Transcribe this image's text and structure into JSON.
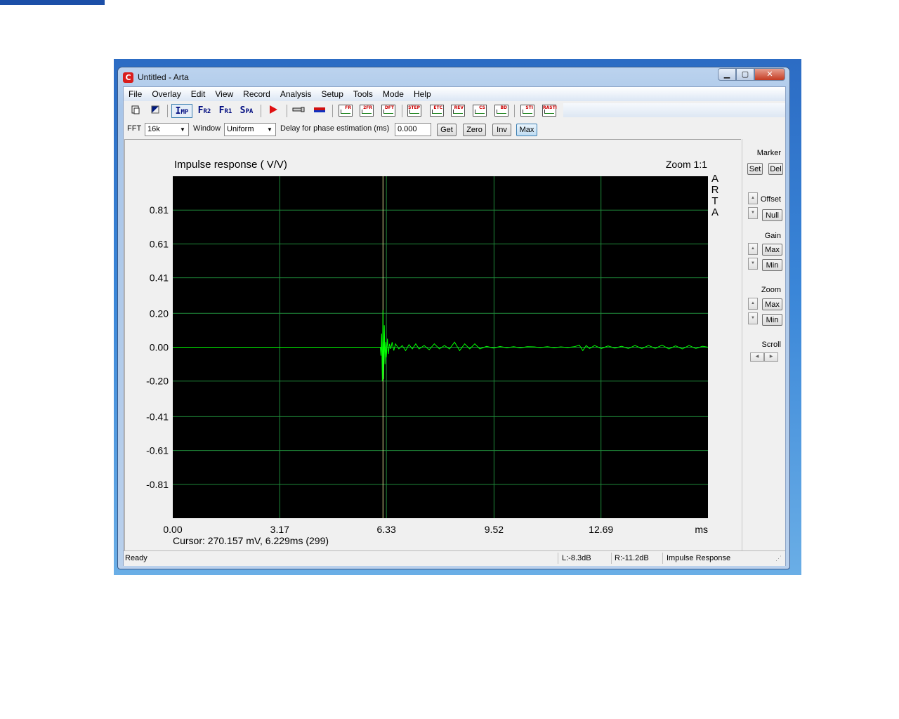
{
  "window": {
    "title": "Untitled - Arta"
  },
  "menu": [
    "File",
    "Overlay",
    "Edit",
    "View",
    "Record",
    "Analysis",
    "Setup",
    "Tools",
    "Mode",
    "Help"
  ],
  "toolbar": {
    "imp": {
      "main": "I",
      "sub": "MP"
    },
    "fr2": {
      "main": "F",
      "sub": "R2"
    },
    "fr1": {
      "main": "F",
      "sub": "R1"
    },
    "spa": {
      "main": "S",
      "sub": "PA"
    },
    "icons": [
      "FR",
      "2FR",
      "DFT",
      "STEP",
      "ETC",
      "REV",
      "CS",
      "BD",
      "STI",
      "RASTI"
    ]
  },
  "options": {
    "fft_label": "FFT",
    "fft_value": "16k",
    "window_label": "Window",
    "window_value": "Uniform",
    "delay_label": "Delay for phase estimation (ms)",
    "delay_value": "0.000",
    "get": "Get",
    "zero": "Zero",
    "inv": "Inv",
    "max": "Max"
  },
  "plot": {
    "title": "Impulse response ( V/V)",
    "zoom": "Zoom 1:1",
    "brand": [
      "A",
      "R",
      "T",
      "A"
    ],
    "cursor": "Cursor: 270.157 mV, 6.229ms (299)",
    "trace_color": "#00ff00",
    "grid_color": "#1f8a3a",
    "background": "#000000"
  },
  "chart_data": {
    "type": "line",
    "title": "Impulse response ( V/V)",
    "xlabel": "ms",
    "ylabel": "",
    "x_ticks": [
      "0.00",
      "3.17",
      "6.33",
      "9.52",
      "12.69"
    ],
    "x_unit": "ms",
    "y_ticks": [
      "0.81",
      "0.61",
      "0.41",
      "0.20",
      "0.00",
      "-0.20",
      "-0.41",
      "-0.61",
      "-0.81"
    ],
    "xlim": [
      0,
      15.86
    ],
    "ylim": [
      -1.01,
      1.01
    ],
    "cursor_x": 6.229,
    "series": [
      {
        "x": [
          0,
          6.15,
          6.17,
          6.19,
          6.21,
          6.23,
          6.25,
          6.27,
          6.29,
          6.31,
          6.33,
          6.36,
          6.39,
          6.42,
          6.46,
          6.5,
          6.55,
          6.6,
          6.7,
          6.8,
          6.9,
          7.0,
          7.1,
          7.2,
          7.3,
          7.45,
          7.6,
          7.75,
          7.9,
          8.05,
          8.2,
          8.35,
          8.5,
          8.65,
          8.8,
          8.95,
          9.1,
          9.3,
          9.5,
          9.7,
          9.9,
          10.1,
          10.3,
          10.5,
          10.7,
          10.9,
          11.1,
          11.3,
          11.5,
          11.7,
          11.9,
          12.05,
          12.15,
          12.25,
          12.35,
          12.5,
          12.7,
          12.9,
          13.1,
          13.3,
          13.5,
          13.7,
          13.9,
          14.1,
          14.3,
          14.5,
          14.7,
          14.9,
          15.1,
          15.3,
          15.5,
          15.7,
          15.86
        ],
        "y": [
          0,
          0,
          -0.05,
          0.08,
          -0.2,
          0.22,
          -0.19,
          0.13,
          -0.1,
          0.03,
          -0.06,
          0.05,
          -0.04,
          0.02,
          -0.01,
          0.03,
          -0.02,
          0.02,
          -0.01,
          0.01,
          -0.02,
          0.015,
          -0.01,
          0.02,
          -0.01,
          0.01,
          -0.015,
          0.02,
          -0.01,
          0.01,
          -0.01,
          0.03,
          -0.02,
          0.02,
          -0.01,
          0.02,
          -0.01,
          0.005,
          -0.005,
          0.004,
          -0.003,
          0.003,
          -0.004,
          0.003,
          0.002,
          -0.002,
          0.003,
          -0.003,
          0.002,
          -0.002,
          0.003,
          0.012,
          -0.02,
          0.01,
          -0.008,
          0.01,
          -0.008,
          0.008,
          -0.006,
          0.006,
          -0.008,
          0.01,
          -0.008,
          0.01,
          -0.007,
          0.012,
          -0.01,
          0.008,
          -0.01,
          0.01,
          -0.008,
          0.006,
          0
        ]
      }
    ]
  },
  "side": {
    "marker": "Marker",
    "set": "Set",
    "del": "Del",
    "offset": "Offset",
    "null": "Null",
    "gain": "Gain",
    "gain_max": "Max",
    "gain_min": "Min",
    "zoom": "Zoom",
    "zoom_max": "Max",
    "zoom_min": "Min",
    "scroll": "Scroll"
  },
  "status": {
    "ready": "Ready",
    "left": "L:-8.3dB",
    "right": "R:-11.2dB",
    "mode": "Impulse Response"
  }
}
